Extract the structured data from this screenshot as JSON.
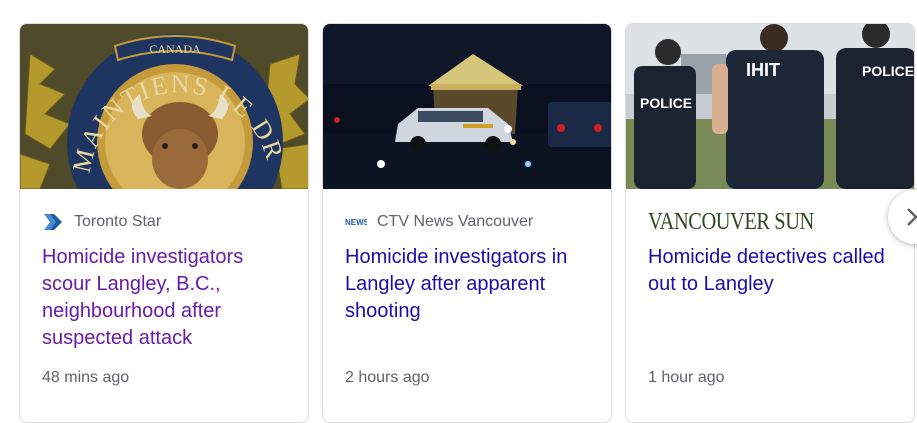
{
  "cards": [
    {
      "image_alt": "RCMP crest",
      "source": "Toronto Star",
      "source_icon": "toronto-star-logo",
      "headline": "Homicide investigators scour Langley, B.C., neighbourhood after suspected attack",
      "time": "48 mins ago",
      "visited": true,
      "crest_text": "MAINTIENS LE DROIT",
      "crest_banner": "CANADA"
    },
    {
      "image_alt": "Night scene with police tent and cruiser",
      "source": "CTV News Vancouver",
      "source_icon": "ctv-news-logo",
      "source_icon_text": "NEWS",
      "headline": "Homicide investigators in Langley after apparent shooting",
      "time": "2 hours ago",
      "visited": false
    },
    {
      "image_alt": "Police officers standing at a scene",
      "source_logo_text": "VANCOUVER SUN",
      "headline": "Homicide detectives called out to Langley",
      "time": "1 hour ago",
      "visited": false,
      "vest_labels": [
        "POLICE",
        "IHIT",
        "POLICE"
      ]
    }
  ],
  "next_button_icon": "chevron-right-icon",
  "colors": {
    "visited_link": "#681da8",
    "link": "#1a0dab",
    "meta": "#5f6368",
    "border": "#dadce0"
  }
}
